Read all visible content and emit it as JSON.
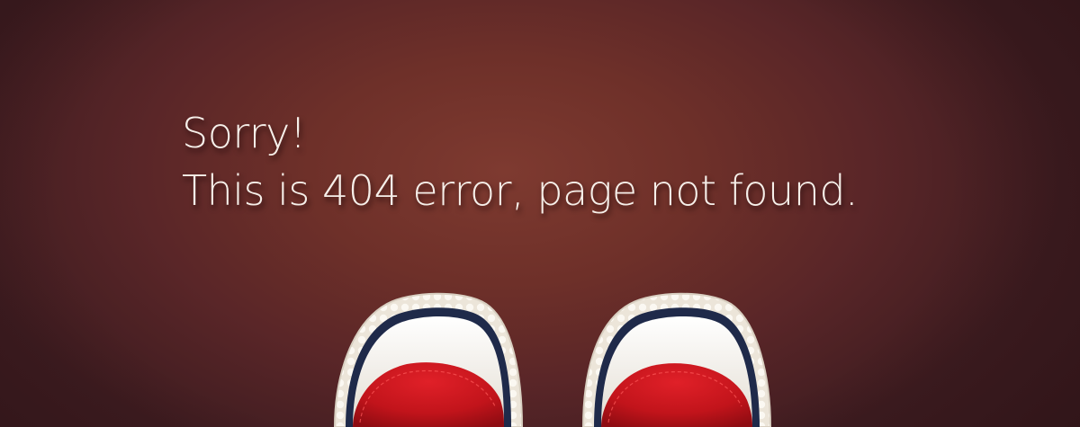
{
  "message": {
    "line1": "Sorry!",
    "line2": "This is 404 error, page not found."
  },
  "colors": {
    "background": "#6e3029",
    "text": "#f6efe9",
    "shoe_red": "#c8161d",
    "shoe_toe": "#f2ede4",
    "shoe_stripe": "#1f2a4a"
  }
}
